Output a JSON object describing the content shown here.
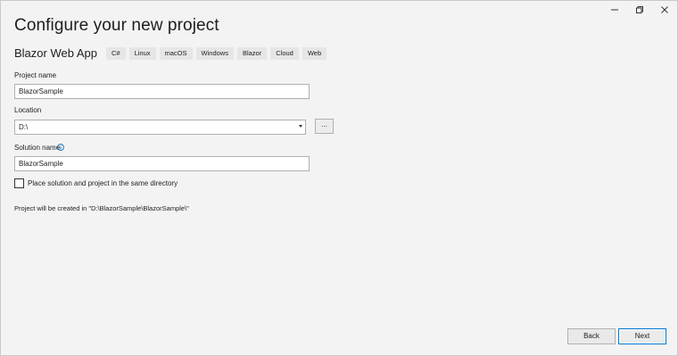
{
  "window": {
    "controls": {
      "minimize_icon": "minimize-icon",
      "restore_icon": "restore-icon",
      "close_icon": "close-icon"
    }
  },
  "page": {
    "title": "Configure your new project"
  },
  "template": {
    "name": "Blazor Web App",
    "tags": [
      "C#",
      "Linux",
      "macOS",
      "Windows",
      "Blazor",
      "Cloud",
      "Web"
    ]
  },
  "form": {
    "project_name": {
      "label": "Project name",
      "value": "BlazorSample"
    },
    "location": {
      "label": "Location",
      "value": "D:\\",
      "browse_label": "..."
    },
    "solution_name": {
      "label": "Solution name",
      "info_icon": "info-icon",
      "value": "BlazorSample"
    },
    "same_directory": {
      "label": "Place solution and project in the same directory",
      "checked": false
    },
    "path_note": "Project will be created in \"D:\\BlazorSample\\BlazorSample\\\""
  },
  "footer": {
    "back_label": "Back",
    "next_label": "Next"
  },
  "colors": {
    "background": "#f3f3f3",
    "accent": "#0078d4",
    "info": "#0063b1"
  }
}
